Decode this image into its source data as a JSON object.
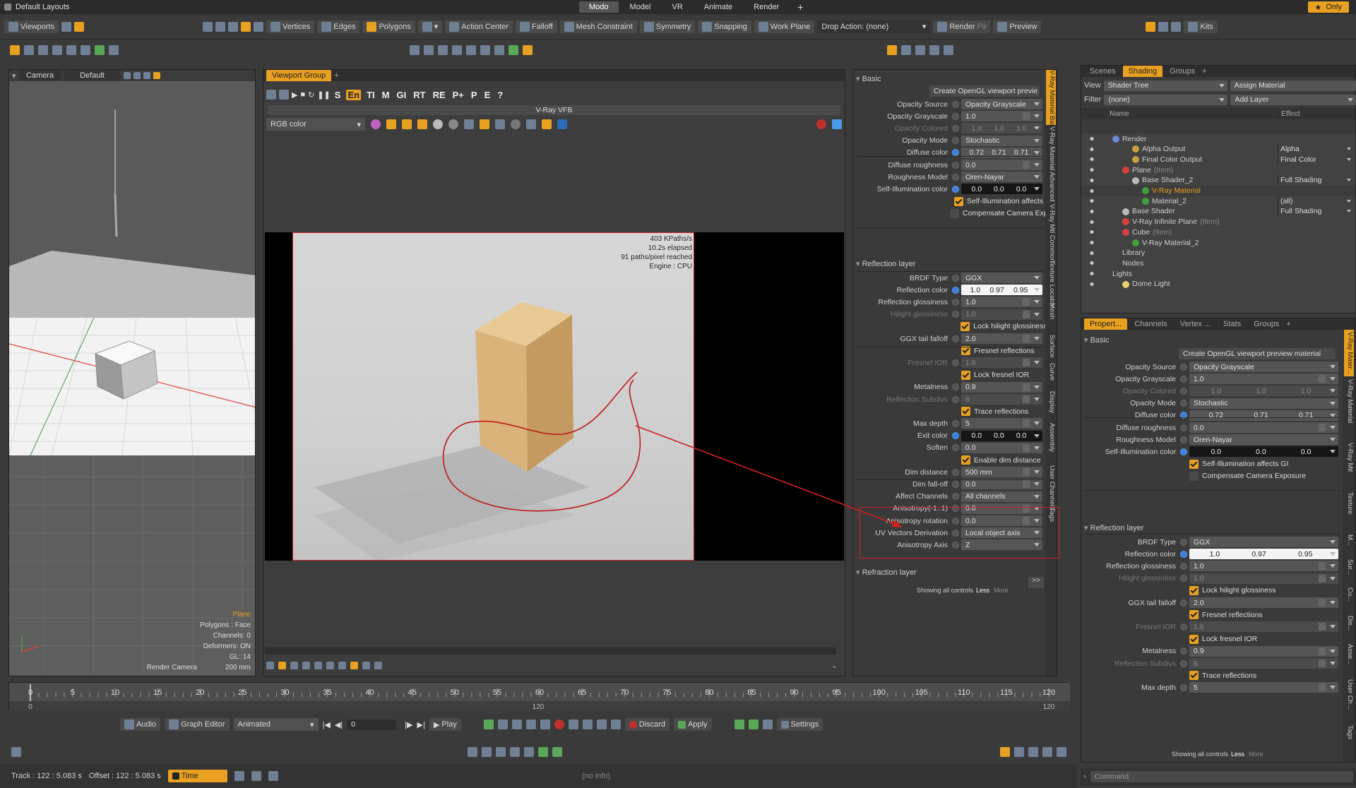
{
  "menubar": {
    "layout": "Default Layouts",
    "tabs": [
      "Modo",
      "Model",
      "VR",
      "Animate",
      "Render"
    ],
    "active_tab": "Modo",
    "plus": "+",
    "right_label": "Only",
    "star": "★"
  },
  "toolbar": {
    "viewports": "Viewports",
    "vertices": "Vertices",
    "edges": "Edges",
    "polygons": "Polygons",
    "action_center": "Action Center",
    "falloff": "Falloff",
    "mesh_constraint": "Mesh Constraint",
    "symmetry": "Symmetry",
    "snapping": "Snapping",
    "work_plane": "Work Plane",
    "drop_action": "Drop Action: (none)",
    "render": "Render",
    "render_key": "F9",
    "preview": "Preview",
    "kits": "Kits"
  },
  "viewport_left": {
    "camera": "Camera",
    "default": "Default",
    "info": {
      "item": "Plane",
      "polygons": "Polygons : Face",
      "channels": "Channels: 0",
      "deformers": "Deformers: ON",
      "gl": "GL: 14",
      "cam": "Render Camera",
      "dist": "200 mm"
    }
  },
  "viewport_group": {
    "tab": "Viewport Group",
    "plus": "+",
    "vfb_title": "V-Ray VFB",
    "channel_select": "RGB color",
    "toolbar_labels": [
      "S",
      "En",
      "TI",
      "M",
      "GI",
      "RT",
      "RE",
      "P+",
      "P",
      "E",
      "?"
    ],
    "stats": [
      "403 KPaths/s",
      "10.2s elapsed",
      "91 paths/pixel reached",
      "Engine : CPU"
    ]
  },
  "props_mid": {
    "basic": "Basic",
    "create_btn": "Create OpenGL viewport previe",
    "rows": [
      {
        "label": "Opacity Source",
        "value": "Opacity Grayscale",
        "type": "select"
      },
      {
        "label": "Opacity Grayscale",
        "value": "1.0",
        "type": "num"
      },
      {
        "label": "Opacity Colored",
        "values": [
          "1.0",
          "1.0",
          "1.0"
        ],
        "type": "tri",
        "dim": true
      },
      {
        "label": "Opacity Mode",
        "value": "Stochastic",
        "type": "select"
      },
      {
        "label": "Diffuse color",
        "values": [
          "0.72",
          "0.71",
          "0.71"
        ],
        "type": "tri",
        "color": "#d8d8d8"
      },
      {
        "label": "Diffuse roughness",
        "value": "0.0",
        "type": "num"
      },
      {
        "label": "Roughness Model",
        "value": "Oren-Nayar",
        "type": "select"
      },
      {
        "label": "Self-Illumination color",
        "values": [
          "0.0",
          "0.0",
          "0.0"
        ],
        "type": "tri",
        "color": "#161616"
      },
      {
        "label": "",
        "value": "Self-Illumination affects GI",
        "type": "chk"
      },
      {
        "label": "",
        "value": "Compensate Camera Expo...",
        "type": "chkoff"
      }
    ],
    "reflection": "Reflection layer",
    "rows2": [
      {
        "label": "BRDF Type",
        "value": "GGX",
        "type": "select"
      },
      {
        "label": "Reflection color",
        "values": [
          "1.0",
          "0.97",
          "0.95"
        ],
        "type": "tri",
        "color": "#f4f4f4"
      },
      {
        "label": "Reflection glossiness",
        "value": "1.0",
        "type": "num"
      },
      {
        "label": "Hilight glossiness",
        "value": "1.0",
        "type": "num",
        "dim": true
      },
      {
        "label": "",
        "value": "Lock hilight glossiness",
        "type": "chk"
      },
      {
        "label": "GGX tail falloff",
        "value": "2.0",
        "type": "num"
      },
      {
        "label": "",
        "value": "Fresnel reflections",
        "type": "chk"
      },
      {
        "label": "Fresnel IOR",
        "value": "1.6",
        "type": "num",
        "dim": true
      },
      {
        "label": "",
        "value": "Lock fresnel IOR",
        "type": "chk"
      },
      {
        "label": "Metalness",
        "value": "0.9",
        "type": "num"
      },
      {
        "label": "Reflection Subdivs",
        "value": "8",
        "type": "num",
        "dim": true
      },
      {
        "label": "",
        "value": "Trace reflections",
        "type": "chk"
      },
      {
        "label": "Max depth",
        "value": "5",
        "type": "num"
      },
      {
        "label": "Exit color",
        "values": [
          "0.0",
          "0.0",
          "0.0"
        ],
        "type": "tri",
        "color": "#161616"
      },
      {
        "label": "Soften",
        "value": "0.0",
        "type": "num"
      },
      {
        "label": "",
        "value": "Enable dim distance",
        "type": "chk"
      },
      {
        "label": "Dim distance",
        "value": "500 mm",
        "type": "num"
      },
      {
        "label": "Dim fall-off",
        "value": "0.0",
        "type": "num"
      },
      {
        "label": "Affect Channels",
        "value": "All channels",
        "type": "select"
      },
      {
        "label": "Anisotropy(-1..1)",
        "value": "0.0",
        "type": "num"
      },
      {
        "label": "Anisotropy rotation",
        "value": "0.0",
        "type": "num"
      },
      {
        "label": "UV Vectors Derivation",
        "value": "Local object axis",
        "type": "select"
      },
      {
        "label": "Anisotropy Axis",
        "value": "Z",
        "type": "select"
      }
    ],
    "refraction": "Refraction layer",
    "footer": "Showing all controls",
    "less": "Less",
    "more": "More",
    "vtabs": [
      "V-Ray Material Basic",
      "V-Ray Material Advanced",
      "V-Ray Mtl Common",
      "Texture Locator",
      "Mesh",
      "Surface",
      "Curve",
      "Display",
      "Assembly",
      "User Channels",
      "Tags"
    ]
  },
  "shader": {
    "tabs": [
      "Scenes",
      "Shading",
      "Groups"
    ],
    "active": "Shading",
    "plus": "+",
    "view_label": "View",
    "view_value": "Shader Tree",
    "assign": "Assign Material",
    "filter_label": "Filter",
    "filter_value": "(none)",
    "add_layer": "Add Layer",
    "col_name": "Name",
    "col_effect": "Effect",
    "rows": [
      {
        "name": "Render",
        "effect": "",
        "indent": 0,
        "color": "#6a8ad8",
        "sel": false
      },
      {
        "name": "Alpha Output",
        "effect": "Alpha",
        "indent": 2,
        "color": "#c8a040",
        "sel": false
      },
      {
        "name": "Final Color Output",
        "effect": "Final Color",
        "indent": 2,
        "color": "#c8a040",
        "sel": false
      },
      {
        "name": "Plane",
        "item": "(Item)",
        "effect": "",
        "indent": 1,
        "color": "#d84040",
        "sel": false
      },
      {
        "name": "Base Shader_2",
        "effect": "Full Shading",
        "indent": 2,
        "color": "#bbbbbb",
        "sel": false
      },
      {
        "name": "V-Ray Material",
        "effect": "",
        "indent": 3,
        "color": "#40a040",
        "sel": true
      },
      {
        "name": "Material_2",
        "effect": "(all)",
        "indent": 3,
        "color": "#40a040",
        "sel": false
      },
      {
        "name": "Base Shader",
        "effect": "Full Shading",
        "indent": 1,
        "color": "#bbbbbb",
        "sel": false
      },
      {
        "name": "V-Ray Infinite Plane",
        "item": "(Item)",
        "effect": "",
        "indent": 1,
        "color": "#d84040",
        "sel": false
      },
      {
        "name": "Cube",
        "item": "(Item)",
        "effect": "",
        "indent": 1,
        "color": "#d84040",
        "sel": false
      },
      {
        "name": "V-Ray Material_2",
        "effect": "",
        "indent": 2,
        "color": "#40a040",
        "sel": false
      },
      {
        "name": "Library",
        "effect": "",
        "indent": 1,
        "color": "",
        "sel": false
      },
      {
        "name": "Nodes",
        "effect": "",
        "indent": 1,
        "color": "",
        "sel": false
      },
      {
        "name": "Lights",
        "effect": "",
        "indent": 0,
        "color": "",
        "sel": false
      },
      {
        "name": "Dome Light",
        "effect": "",
        "indent": 1,
        "color": "#e8d070",
        "sel": false
      }
    ]
  },
  "props_right": {
    "tabs": [
      "Propert...",
      "Channels",
      "Vertex ...",
      "Stats",
      "Groups"
    ],
    "plus": "+",
    "basic": "Basic",
    "create_btn": "Create OpenGL viewport preview material",
    "rows": [
      {
        "label": "Opacity Source",
        "value": "Opacity Grayscale",
        "type": "select"
      },
      {
        "label": "Opacity Grayscale",
        "value": "1.0",
        "type": "num"
      },
      {
        "label": "Opacity Colored",
        "values": [
          "1.0",
          "1.0",
          "1.0"
        ],
        "type": "tri",
        "dim": true
      },
      {
        "label": "Opacity Mode",
        "value": "Stochastic",
        "type": "select"
      },
      {
        "label": "Diffuse color",
        "values": [
          "0.72",
          "0.71",
          "0.71"
        ],
        "type": "tri",
        "color": "#d8d8d8"
      },
      {
        "label": "Diffuse roughness",
        "value": "0.0",
        "type": "num"
      },
      {
        "label": "Roughness Model",
        "value": "Oren-Nayar",
        "type": "select"
      },
      {
        "label": "Self-Illumination color",
        "values": [
          "0.0",
          "0.0",
          "0.0"
        ],
        "type": "tri",
        "color": "#161616"
      },
      {
        "label": "",
        "value": "Self-Illumination affects GI",
        "type": "chk"
      },
      {
        "label": "",
        "value": "Compensate Camera Exposure",
        "type": "chkoff"
      }
    ],
    "reflection": "Reflection layer",
    "rows2": [
      {
        "label": "BRDF Type",
        "value": "GGX",
        "type": "select"
      },
      {
        "label": "Reflection color",
        "values": [
          "1.0",
          "0.97",
          "0.95"
        ],
        "type": "tri",
        "color": "#f4f4f4"
      },
      {
        "label": "Reflection glossiness",
        "value": "1.0",
        "type": "num"
      },
      {
        "label": "Hilight glossiness",
        "value": "1.0",
        "type": "num",
        "dim": true
      },
      {
        "label": "",
        "value": "Lock hilight glossiness",
        "type": "chk"
      },
      {
        "label": "GGX tail falloff",
        "value": "2.0",
        "type": "num"
      },
      {
        "label": "",
        "value": "Fresnel reflections",
        "type": "chk"
      },
      {
        "label": "Fresnel IOR",
        "value": "1.6",
        "type": "num",
        "dim": true
      },
      {
        "label": "",
        "value": "Lock fresnel IOR",
        "type": "chk"
      },
      {
        "label": "Metalness",
        "value": "0.9",
        "type": "num"
      },
      {
        "label": "Reflection Subdivs",
        "value": "8",
        "type": "num",
        "dim": true
      },
      {
        "label": "",
        "value": "Trace reflections",
        "type": "chk"
      },
      {
        "label": "Max depth",
        "value": "5",
        "type": "num"
      }
    ],
    "footer": "Showing all controls",
    "less": "Less",
    "more": "More",
    "vtabs": [
      "V-Ray Mater...",
      "V-Ray Material",
      "V-Ray Mtl",
      "Texture",
      "M...",
      "Sur...",
      "Cu...",
      "Dis...",
      "Asse...",
      "User Ch...",
      "Tags"
    ],
    "command": "Command"
  },
  "timeline": {
    "ticks": [
      "0",
      "5",
      "10",
      "15",
      "20",
      "25",
      "30",
      "35",
      "40",
      "45",
      "50",
      "55",
      "60",
      "65",
      "70",
      "75",
      "80",
      "85",
      "90",
      "95",
      "100",
      "105",
      "110",
      "115",
      "120"
    ],
    "start": "0",
    "end": "120",
    "mid": "120"
  },
  "transport": {
    "audio": "Audio",
    "graph_editor": "Graph Editor",
    "animated": "Animated",
    "frame": "0",
    "play": "Play",
    "discard": "Discard",
    "apply": "Apply",
    "settings": "Settings"
  },
  "status": {
    "track": "Track  :  122 : 5.083 s",
    "offset": "Offset  :  122 : 5.083 s",
    "time": "Time",
    "info": "(no info)"
  }
}
